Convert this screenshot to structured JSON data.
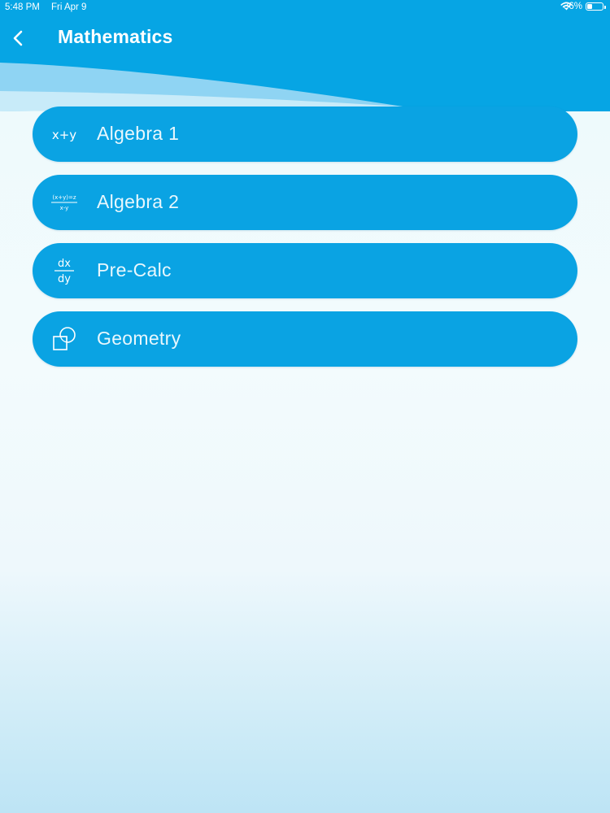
{
  "status_bar": {
    "time": "5:48 PM",
    "date": "Fri Apr 9",
    "battery_percent": "36%",
    "battery_level": 0.36,
    "wifi_icon": "wifi-icon",
    "battery_icon": "battery-icon"
  },
  "header": {
    "title": "Mathematics",
    "back_icon": "chevron-left-icon",
    "background_color": "#06a5e4"
  },
  "subjects": [
    {
      "label": "Algebra 1",
      "icon": "x-plus-y-icon",
      "icon_text": "x+y"
    },
    {
      "label": "Algebra 2",
      "icon": "fraction-equation-icon",
      "icon_numerator": "(x+y)=z",
      "icon_denominator": "x-y"
    },
    {
      "label": "Pre-Calc",
      "icon": "derivative-icon",
      "icon_numerator": "dx",
      "icon_denominator": "dy"
    },
    {
      "label": "Geometry",
      "icon": "shapes-icon"
    }
  ],
  "colors": {
    "accent": "#0aa3e3",
    "label_text": "#e8f7fd"
  }
}
